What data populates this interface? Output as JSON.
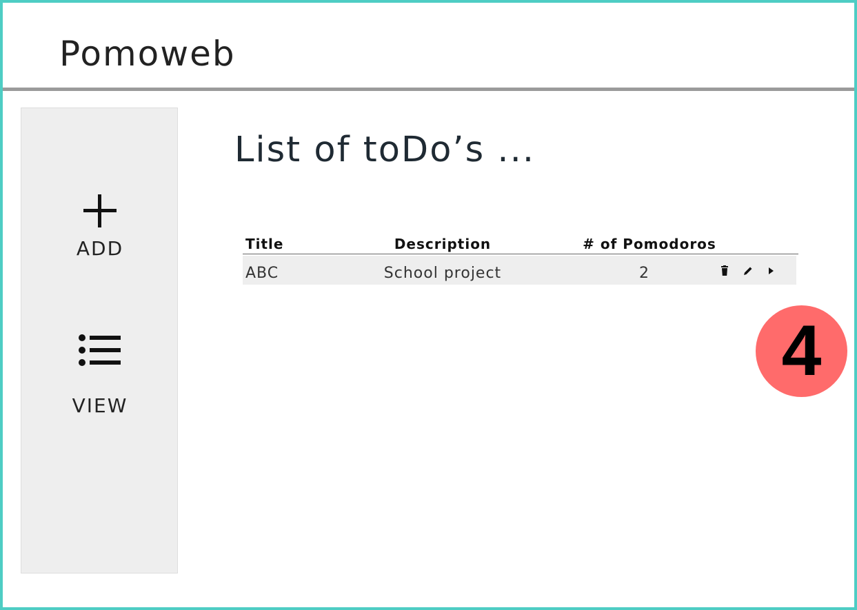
{
  "app": {
    "title": "Pomoweb"
  },
  "sidebar": {
    "items": [
      {
        "label": "ADD",
        "icon": "plus-icon"
      },
      {
        "label": "VIEW",
        "icon": "list-icon"
      }
    ]
  },
  "main": {
    "title": "List of toDo’s ...",
    "table": {
      "headers": {
        "title": "Title",
        "description": "Description",
        "pomodoros": "# of Pomodoros"
      },
      "rows": [
        {
          "title": "ABC",
          "description": "School project",
          "pomodoros": "2",
          "actions": [
            "trash-icon",
            "pencil-icon",
            "play-icon"
          ]
        }
      ]
    }
  },
  "annotation": {
    "badge_number": "4",
    "badge_color": "#ff6b6b"
  },
  "colors": {
    "frame": "#4ecdc4",
    "divider": "#9b9b9b",
    "sidebar_bg": "#eeeeee",
    "row_bg": "#eeeeee"
  }
}
